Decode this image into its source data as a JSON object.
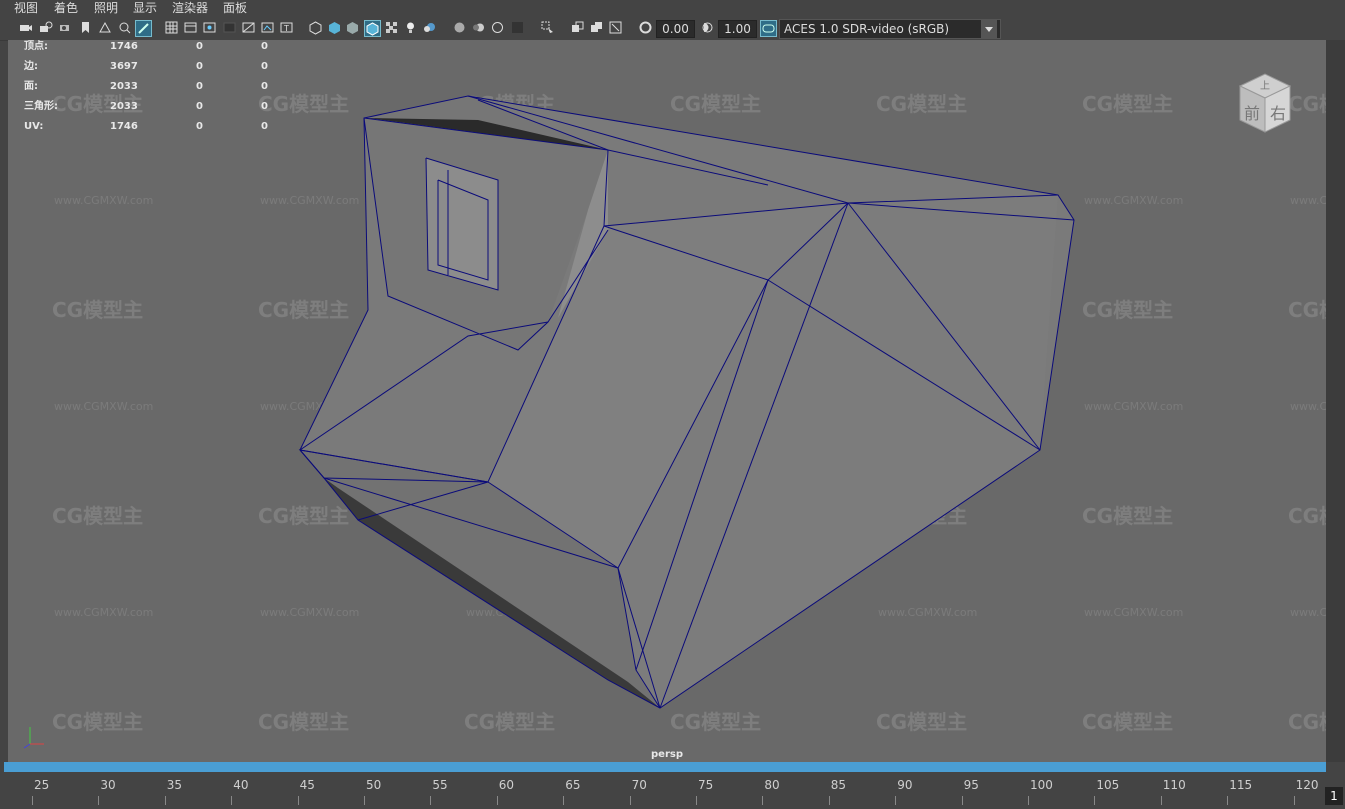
{
  "menu": [
    {
      "label": "视图"
    },
    {
      "label": "着色"
    },
    {
      "label": "照明"
    },
    {
      "label": "显示"
    },
    {
      "label": "渲染器"
    },
    {
      "label": "面板"
    }
  ],
  "toolbar": {
    "exposure_value": "0.00",
    "gamma_value": "1.00",
    "colorspace_label": "ACES 1.0 SDR-video (sRGB)"
  },
  "hud": {
    "rows": [
      {
        "label": "顶点:",
        "c1": "1746",
        "c2": "0",
        "c3": "0"
      },
      {
        "label": "边:",
        "c1": "3697",
        "c2": "0",
        "c3": "0"
      },
      {
        "label": "面:",
        "c1": "2033",
        "c2": "0",
        "c3": "0"
      },
      {
        "label": "三角形:",
        "c1": "2033",
        "c2": "0",
        "c3": "0"
      },
      {
        "label": "UV:",
        "c1": "1746",
        "c2": "0",
        "c3": "0"
      }
    ]
  },
  "viewcube": {
    "top_face": "上",
    "front_face": "前",
    "right_face": "右"
  },
  "camera_label": "persp",
  "watermark": {
    "brand": "CG模型主",
    "url": "www.CGMXW.com"
  },
  "timeline": {
    "ticks": [
      "25",
      "30",
      "35",
      "40",
      "45",
      "50",
      "55",
      "60",
      "65",
      "70",
      "75",
      "80",
      "85",
      "90",
      "95",
      "100",
      "105",
      "110",
      "115",
      "120"
    ],
    "current_frame": "1"
  },
  "colors": {
    "wire": "#0b0b7a",
    "viewport_bg": "#696969",
    "timebar": "#4a9ed4"
  }
}
